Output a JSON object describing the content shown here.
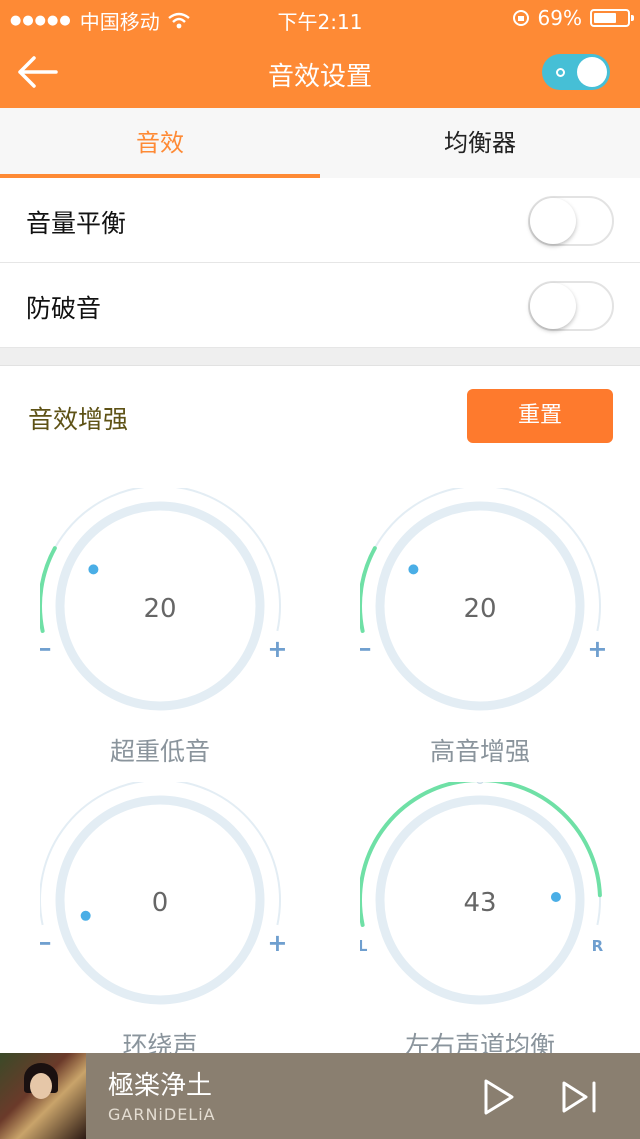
{
  "status_bar": {
    "carrier": "中国移动",
    "time": "下午2:11",
    "battery": "69%",
    "battery_level": 0.69,
    "signal_dots": "●●●●●"
  },
  "nav": {
    "title": "音效设置",
    "back_icon": "arrow-left-icon",
    "master_switch_on": true
  },
  "tabs": [
    {
      "label": "音效",
      "active": true
    },
    {
      "label": "均衡器",
      "active": false
    }
  ],
  "toggles": [
    {
      "label": "音量平衡",
      "on": false
    },
    {
      "label": "防破音",
      "on": false
    }
  ],
  "enhance": {
    "title": "音效增强",
    "reset_label": "重置"
  },
  "knobs": [
    {
      "label": "超重低音",
      "value": "20",
      "min_mark": "−",
      "max_mark": "+",
      "level": 0.2,
      "type": "min-max"
    },
    {
      "label": "高音增强",
      "value": "20",
      "min_mark": "−",
      "max_mark": "+",
      "level": 0.2,
      "type": "min-max"
    },
    {
      "label": "环绕声",
      "value": "0",
      "min_mark": "−",
      "max_mark": "+",
      "level": 0.0,
      "type": "min-max"
    },
    {
      "label": "左右声道均衡",
      "value": "43",
      "min_mark": "L",
      "max_mark": "R",
      "level": 0.93,
      "type": "balance"
    }
  ],
  "player": {
    "song": "極楽浄土",
    "artist": "GARNiDELiA"
  },
  "colors": {
    "accent": "#fe8a35",
    "arc_active": "#6fe0a6",
    "arc_track": "#e3edf4",
    "knob_dot": "#4aaee6",
    "toggle_on": "#46bfd6"
  }
}
